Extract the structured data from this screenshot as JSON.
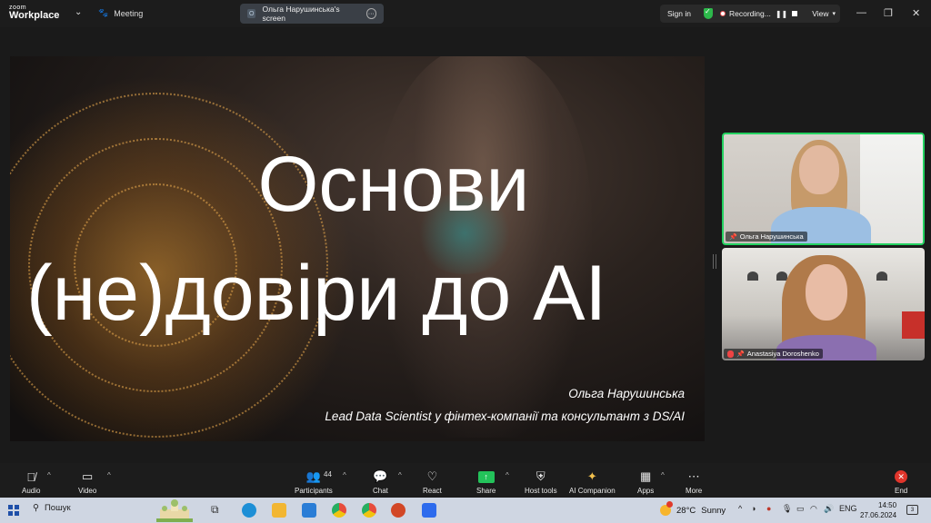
{
  "app": {
    "logo_line1": "zoom",
    "logo_line2": "Workplace",
    "meeting_label": "Meeting",
    "screen_share_label": "Ольга Нарушинська's screen",
    "sign_in": "Sign in",
    "recording_label": "Recording...",
    "view_label": "View",
    "accent_green": "#23d160",
    "recording_red": "#e55555"
  },
  "slide": {
    "title_line1": "Основи",
    "title_line2": "(не)довіри до AI",
    "author": "Ольга Нарушинська",
    "role": "Lead Data Scientist у фінтех-компанії та консультант з DS/AI"
  },
  "participants": [
    {
      "name": "Ольга Нарушинська",
      "speaking": true,
      "muted": false,
      "pinned": true
    },
    {
      "name": "Anastasiya Doroshenko",
      "speaking": false,
      "muted": true,
      "pinned": true
    }
  ],
  "toolbar": {
    "audio": "Audio",
    "video": "Video",
    "participants": "Participants",
    "participants_count": "44",
    "chat": "Chat",
    "react": "React",
    "share": "Share",
    "host_tools": "Host tools",
    "ai_companion": "AI Companion",
    "apps": "Apps",
    "more": "More",
    "end": "End"
  },
  "taskbar": {
    "search_label": "Пошук",
    "weather_temp": "28°C",
    "weather_text": "Sunny",
    "lang": "ENG",
    "time": "14:50",
    "date": "27.06.2024",
    "notification_count": "3"
  },
  "icons": {
    "top": [
      "chevron-down-icon",
      "paw-icon",
      "more-icon",
      "shield-check-icon",
      "pause-icon",
      "stop-icon",
      "minimize-icon",
      "maximize-icon",
      "close-icon"
    ],
    "toolbar": [
      "mic-off-icon",
      "video-icon",
      "participants-icon",
      "chat-icon",
      "heart-icon",
      "share-screen-icon",
      "shield-icon",
      "sparkle-icon",
      "apps-icon",
      "ellipsis-icon",
      "end-call-icon"
    ]
  }
}
